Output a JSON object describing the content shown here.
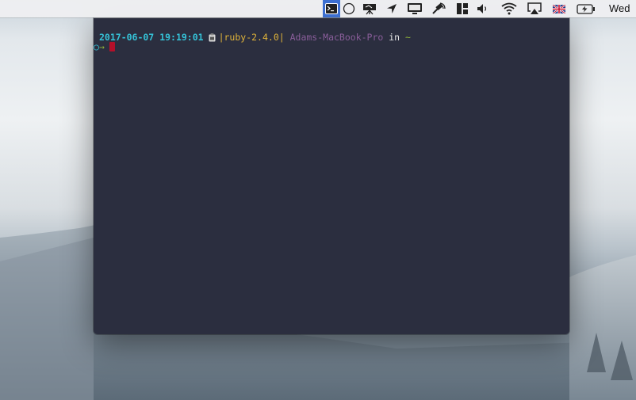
{
  "menubar": {
    "icons": [
      "terminal-icon",
      "circle-icon",
      "keynote-icon",
      "location-arrow-icon",
      "display-icon",
      "satellite-icon",
      "window-layout-icon",
      "volume-icon",
      "wifi-icon",
      "airplay-icon",
      "uk-flag-icon",
      "battery-charging-icon"
    ],
    "clock": "Wed"
  },
  "terminal": {
    "prompt": {
      "date": "2017-06-07",
      "time": "19:19:01",
      "ruby": "|ruby-2.4.0|",
      "host": "Adams-MacBook-Pro",
      "in_word": "in",
      "cwd": "~",
      "status_symbol": "○",
      "arrow": "→"
    }
  },
  "colors": {
    "terminal_bg": "#2b2e3f",
    "cyan": "#35c3d8",
    "yellow": "#e0b43a",
    "purple": "#8a5e9a",
    "green": "#8fb33a",
    "cursor": "#b3102a",
    "menubar_active": "#3c6fd1"
  }
}
